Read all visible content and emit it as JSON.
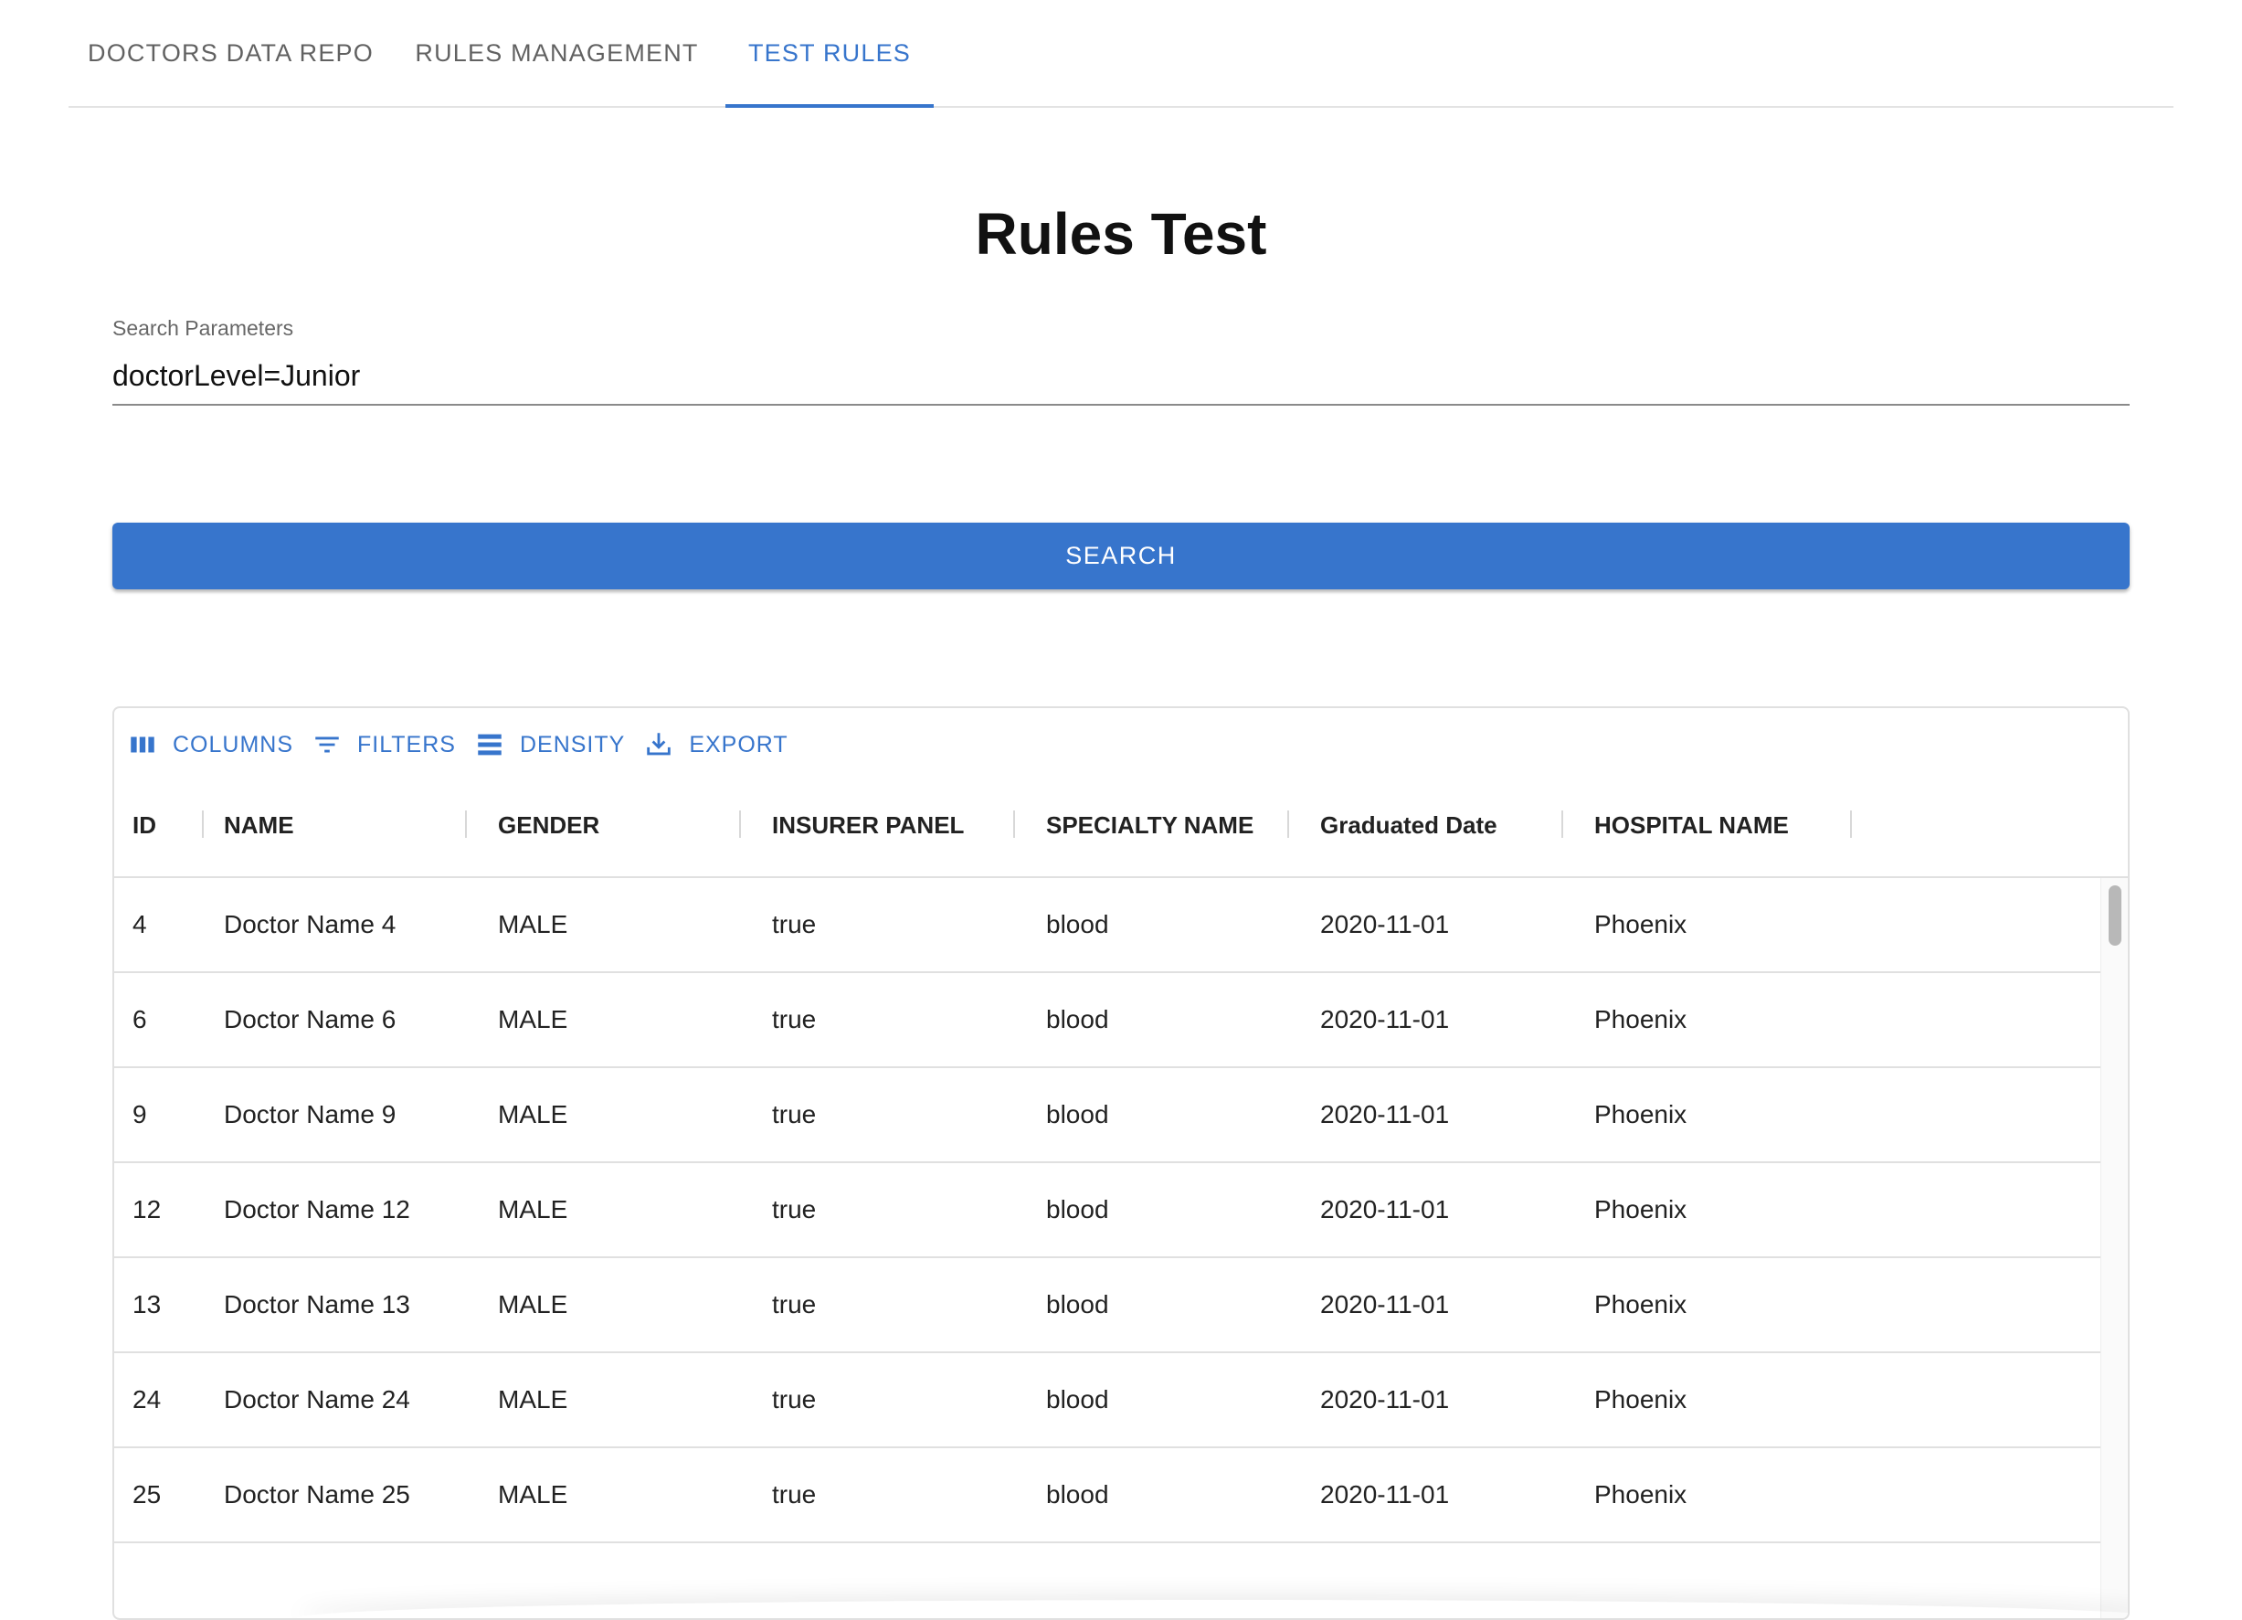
{
  "tabs": [
    {
      "label": "DOCTORS DATA REPO"
    },
    {
      "label": "RULES MANAGEMENT"
    },
    {
      "label": "TEST RULES"
    }
  ],
  "active_tab": "TEST RULES",
  "title": "Rules Test",
  "search": {
    "label": "Search Parameters",
    "value": "doctorLevel=Junior"
  },
  "search_button": "SEARCH",
  "toolbar": {
    "columns": {
      "label": "COLUMNS",
      "icon": "view-column-icon"
    },
    "filters": {
      "label": "FILTERS",
      "icon": "filter-list-icon"
    },
    "density": {
      "label": "DENSITY",
      "icon": "density-icon"
    },
    "export": {
      "label": "EXPORT",
      "icon": "download-icon"
    }
  },
  "columns": [
    "ID",
    "NAME",
    "GENDER",
    "INSURER PANEL",
    "SPECIALTY NAME",
    "Graduated Date",
    "HOSPITAL NAME"
  ],
  "rows": [
    [
      "4",
      "Doctor Name 4",
      "MALE",
      "true",
      "blood",
      "2020-11-01",
      "Phoenix"
    ],
    [
      "6",
      "Doctor Name 6",
      "MALE",
      "true",
      "blood",
      "2020-11-01",
      "Phoenix"
    ],
    [
      "9",
      "Doctor Name 9",
      "MALE",
      "true",
      "blood",
      "2020-11-01",
      "Phoenix"
    ],
    [
      "12",
      "Doctor Name 12",
      "MALE",
      "true",
      "blood",
      "2020-11-01",
      "Phoenix"
    ],
    [
      "13",
      "Doctor Name 13",
      "MALE",
      "true",
      "blood",
      "2020-11-01",
      "Phoenix"
    ],
    [
      "24",
      "Doctor Name 24",
      "MALE",
      "true",
      "blood",
      "2020-11-01",
      "Phoenix"
    ],
    [
      "25",
      "Doctor Name 25",
      "MALE",
      "true",
      "blood",
      "2020-11-01",
      "Phoenix"
    ]
  ],
  "colors": {
    "accent": "#3775cc",
    "border": "#e0e0e0"
  }
}
